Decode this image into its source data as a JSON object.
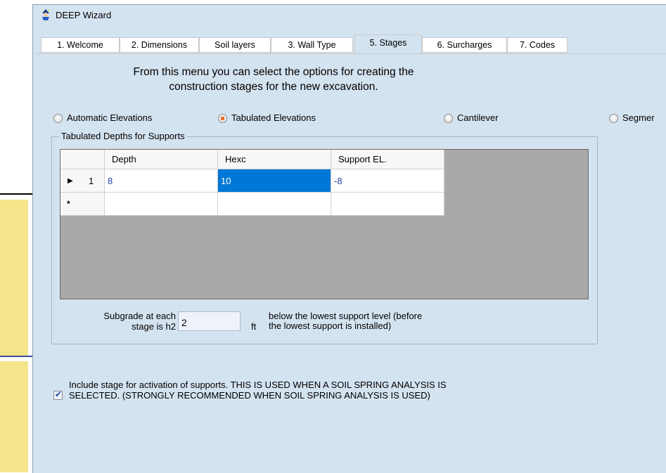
{
  "window": {
    "title": "DEEP Wizard",
    "icon": "wizard-app-icon"
  },
  "tabs": [
    {
      "label": "1. Welcome",
      "active": false
    },
    {
      "label": "2. Dimensions",
      "active": false
    },
    {
      "label": "Soil layers",
      "active": false
    },
    {
      "label": "3. Wall Type",
      "active": false
    },
    {
      "label": "5. Stages",
      "active": true
    },
    {
      "label": "6. Surcharges",
      "active": false
    },
    {
      "label": "7. Codes",
      "active": false
    }
  ],
  "intro": {
    "line1": "From this menu you can select the options for creating the",
    "line2": "construction stages for the new excavation."
  },
  "options": [
    {
      "label": "Automatic Elevations",
      "checked": false
    },
    {
      "label": "Tabulated Elevations",
      "checked": true
    },
    {
      "label": "Cantilever",
      "checked": false
    },
    {
      "label": "Segmer",
      "checked": false
    }
  ],
  "group": {
    "title": "Tabulated Depths for Supports"
  },
  "table": {
    "columns": [
      "Depth",
      "Hexc",
      "Support EL."
    ],
    "rows": [
      {
        "row_marker": "▶",
        "index": "1",
        "cells": [
          "8",
          "10",
          "-8"
        ],
        "selected_col": 1
      },
      {
        "row_marker": "*",
        "index": "",
        "cells": [
          "",
          "",
          ""
        ]
      }
    ]
  },
  "subgrade": {
    "label_line1": "Subgrade at each",
    "label_line2": "stage is h2",
    "value": "2",
    "unit": "ft",
    "note_line1": "below the lowest support level (before",
    "note_line2": "the lowest support is installed)"
  },
  "activation": {
    "checked": true,
    "text_line1": "Include stage for activation of supports. THIS IS USED WHEN A SOIL SPRING ANALYSIS IS",
    "text_line2": "SELECTED. (STRONGLY RECOMMENDED WHEN SOIL SPRING ANALYSIS IS USED)"
  },
  "colors": {
    "panel": "#d4e3f0",
    "selection": "#0078d7",
    "radio_checked": "#e86a1f",
    "cell_text": "#2244aa",
    "background_yellow": "#f5e58a"
  }
}
